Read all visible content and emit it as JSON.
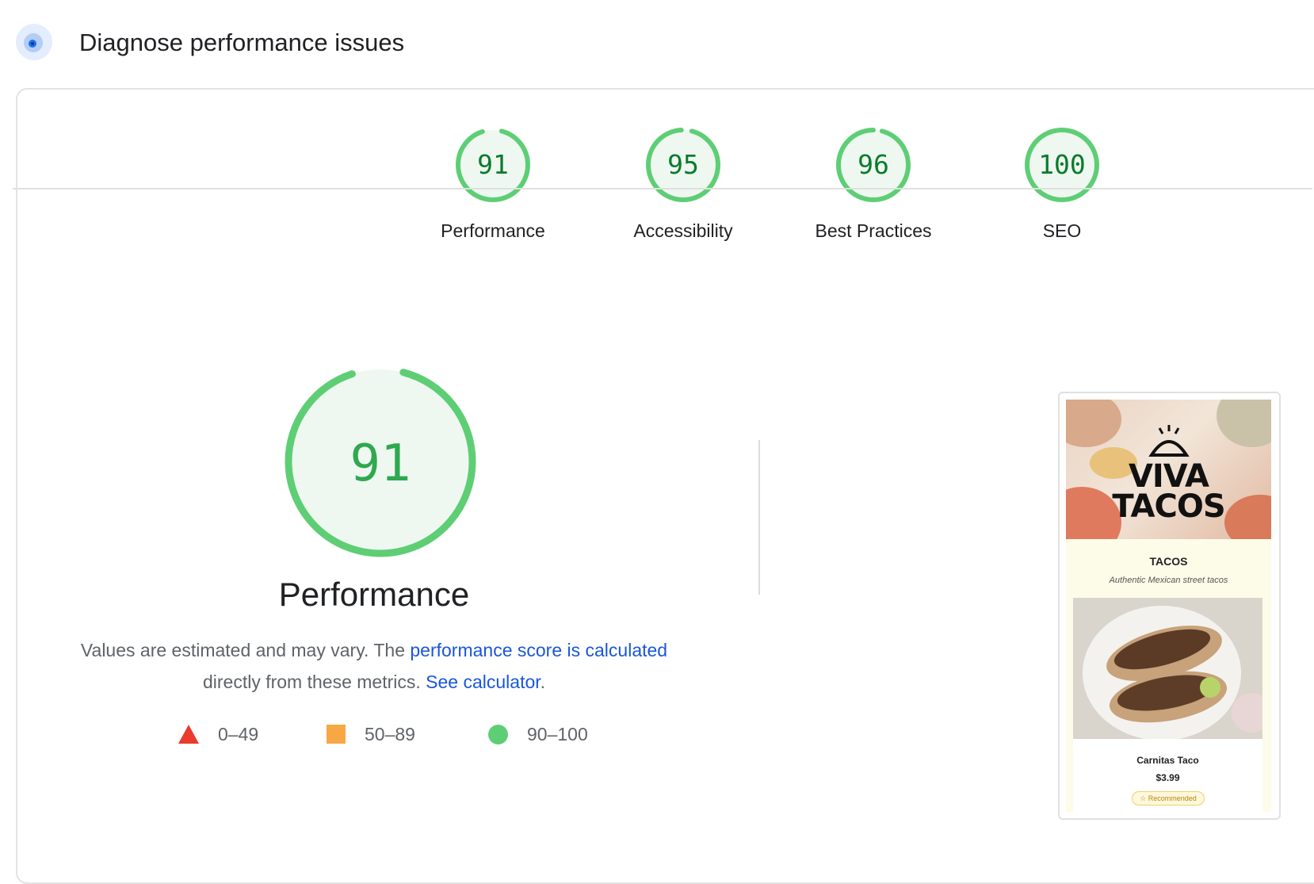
{
  "header": {
    "title": "Diagnose performance issues",
    "icon": "lighthouse-icon"
  },
  "categories": [
    {
      "label": "Performance",
      "score": 91
    },
    {
      "label": "Accessibility",
      "score": 95
    },
    {
      "label": "Best Practices",
      "score": 96
    },
    {
      "label": "SEO",
      "score": 100
    }
  ],
  "performance": {
    "score": 91,
    "title": "Performance",
    "description_prefix": "Values are estimated and may vary. The ",
    "link_score": "performance score is calculated",
    "description_middle": " directly from these metrics. ",
    "link_calculator": "See calculator",
    "description_suffix": "."
  },
  "legend": [
    {
      "shape": "triangle",
      "range": "0–49",
      "color": "#eb3b2e"
    },
    {
      "shape": "square",
      "range": "50–89",
      "color": "#f7a844"
    },
    {
      "shape": "circle",
      "range": "90–100",
      "color": "#5ece75"
    }
  ],
  "screenshot": {
    "hero_title_line1": "VIVA",
    "hero_title_line2": "TACOS",
    "section_title": "TACOS",
    "section_subtitle": "Authentic Mexican street tacos",
    "item_name": "Carnitas Taco",
    "item_price": "$3.99",
    "item_badge": "Recommended"
  },
  "colors": {
    "pass_ring": "#5ece75",
    "pass_fill": "#eef8f1",
    "pass_text": "#0a7b29",
    "link": "#1a56db"
  }
}
